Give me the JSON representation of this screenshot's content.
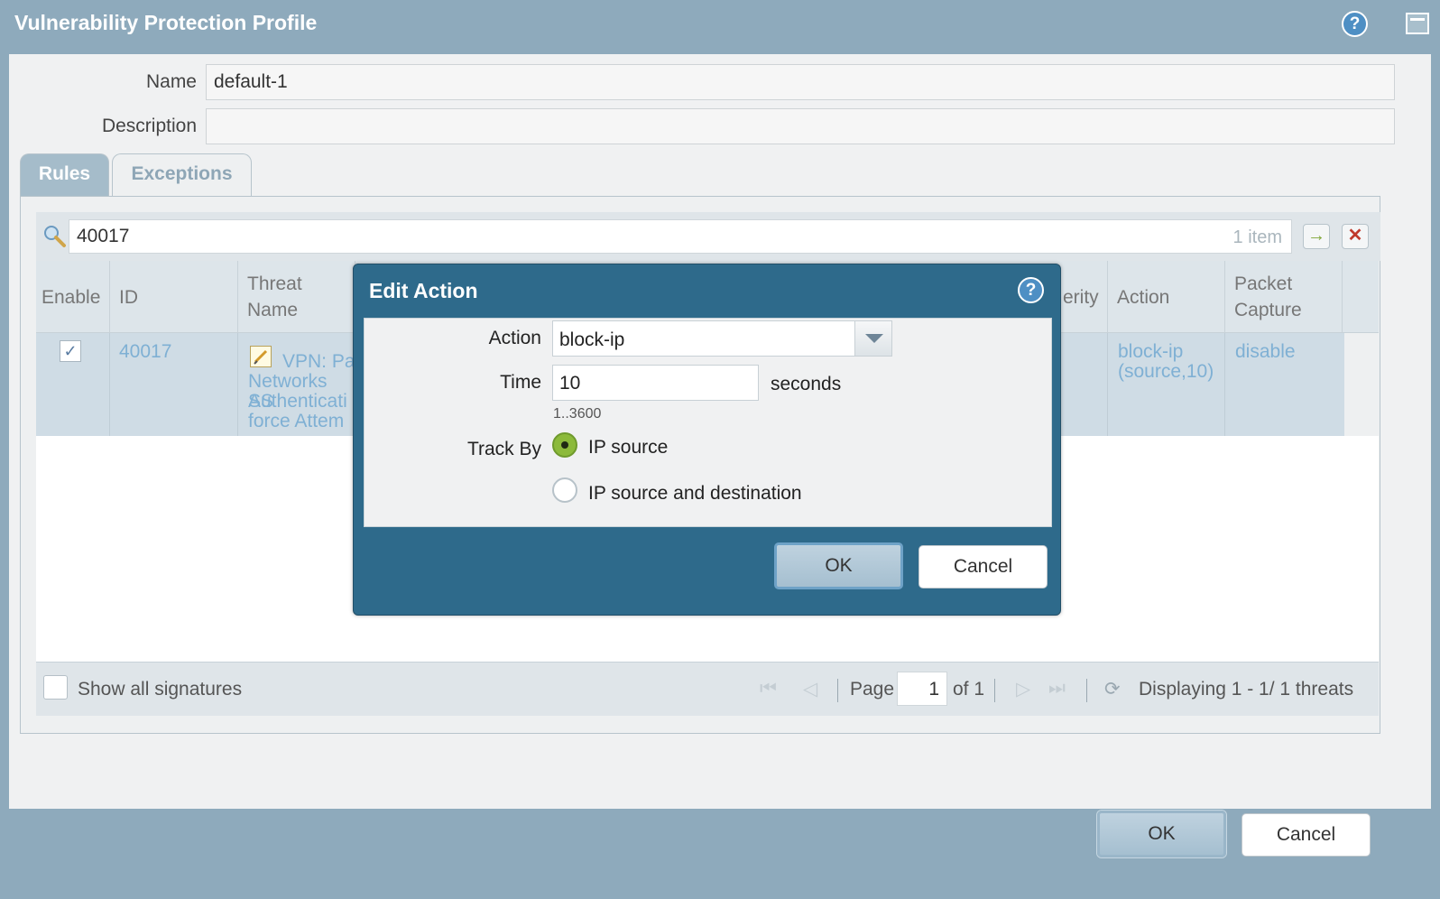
{
  "window": {
    "title": "Vulnerability Protection Profile",
    "help_icon": "?"
  },
  "form": {
    "name_label": "Name",
    "name_value": "default-1",
    "description_label": "Description",
    "description_value": ""
  },
  "tabs": [
    {
      "label": "Rules"
    },
    {
      "label": "Exceptions"
    }
  ],
  "search": {
    "value": "40017",
    "count": "1 item"
  },
  "table": {
    "headers": {
      "enable": "Enable",
      "id": "ID",
      "threat_name": "Threat Name",
      "severity": "erity",
      "action": "Action",
      "packet_capture_1": "Packet",
      "packet_capture_2": "Capture"
    },
    "row": {
      "enabled_mark": "✓",
      "id": "40017",
      "threat_lines": [
        "VPN: Pa",
        "Networks SS",
        "Authenticati",
        "force Attem"
      ],
      "action_lines": [
        "block-ip",
        "(source,10)"
      ],
      "packet_capture": "disable"
    }
  },
  "footer": {
    "show_all_label": "Show all signatures",
    "page_label": "Page",
    "page_value": "1",
    "of_label": "of 1",
    "displaying": "Displaying 1 - 1/ 1 threats"
  },
  "buttons": {
    "ok": "OK",
    "cancel": "Cancel"
  },
  "modal": {
    "title": "Edit Action",
    "help_icon": "?",
    "action_label": "Action",
    "action_value": "block-ip",
    "time_label": "Time",
    "time_value": "10",
    "time_unit": "seconds",
    "time_range": "1..3600",
    "track_by_label": "Track By",
    "track_options": [
      "IP source",
      "IP source and destination"
    ],
    "selected_track": "IP source",
    "ok": "OK",
    "cancel": "Cancel"
  },
  "colors": {
    "frame": "#8eaabc",
    "modal": "#2e6a8b",
    "link": "#7fb0d4",
    "radio_on": "#8cba3b"
  }
}
